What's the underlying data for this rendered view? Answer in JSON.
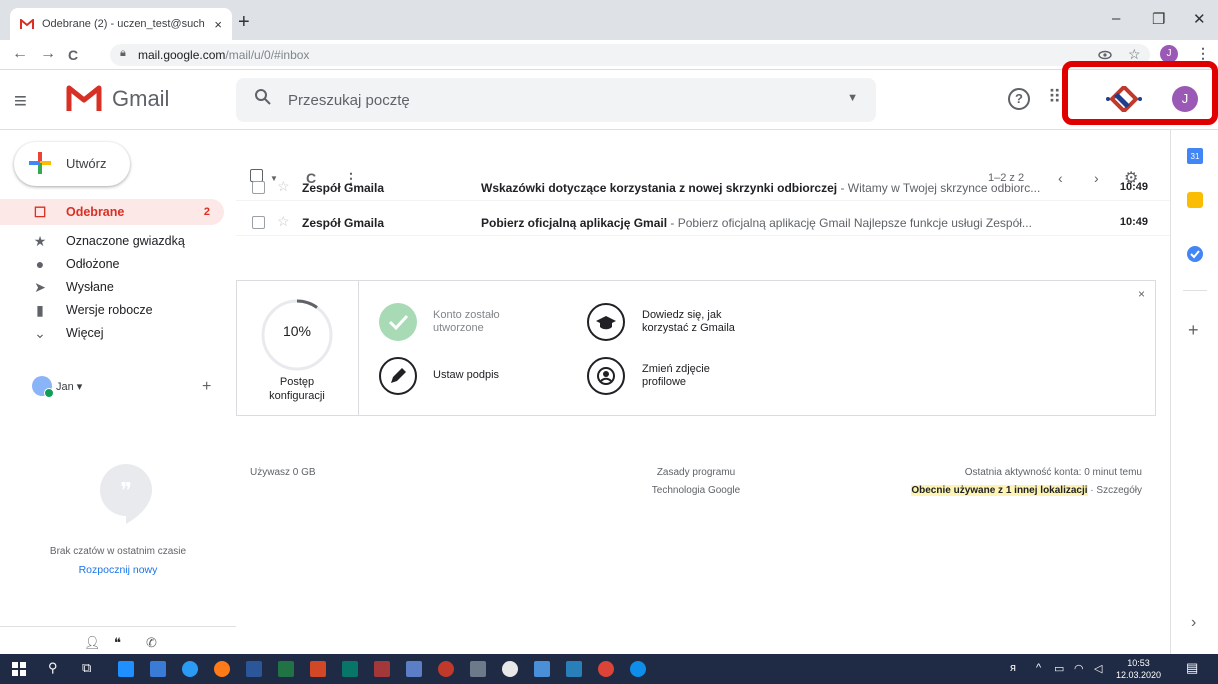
{
  "browser": {
    "tab_title": "Odebrane (2) - uczen_test@such",
    "tab_close": "×",
    "new_tab": "+",
    "url_host": "mail.google.com",
    "url_path": "/mail/u/0/#inbox",
    "window_controls": [
      "–",
      "❐",
      "✕"
    ],
    "nav": [
      "←",
      "→",
      "C"
    ]
  },
  "header": {
    "logo_text": "Gmail",
    "search_placeholder": "Przeszukaj pocztę",
    "help": "?",
    "avatar_letter": "J"
  },
  "sidebar": {
    "compose": "Utwórz",
    "items": [
      {
        "label": "Odebrane",
        "count": "2",
        "icon": "inbox-icon",
        "glyph": "☐"
      },
      {
        "label": "Oznaczone gwiazdką",
        "icon": "star-icon",
        "glyph": "★"
      },
      {
        "label": "Odłożone",
        "icon": "clock-icon",
        "glyph": "●"
      },
      {
        "label": "Wysłane",
        "icon": "send-icon",
        "glyph": "➤"
      },
      {
        "label": "Wersje robocze",
        "icon": "draft-icon",
        "glyph": "▮"
      },
      {
        "label": "Więcej",
        "icon": "chevron-down-icon",
        "glyph": "⌄"
      }
    ],
    "user_name": "Jan ▾",
    "user_plus": "+",
    "no_chats": "Brak czatów w ostatnim czasie",
    "start_new": "Rozpocznij nowy"
  },
  "toolbar": {
    "paging": "1–2 z 2"
  },
  "emails": [
    {
      "from": "Zespół Gmaila",
      "subject": "Wskazówki dotyczące korzystania z nowej skrzynki odbiorczej",
      "snippet": " - Witamy w Twojej skrzynce odbiorc...",
      "time": "10:49"
    },
    {
      "from": "Zespół Gmaila",
      "subject": "Pobierz oficjalną aplikację Gmail",
      "snippet": " - Pobierz oficjalną aplikację Gmail Najlepsze funkcje usługi Zespół...",
      "time": "10:49"
    }
  ],
  "setup": {
    "percent": "10%",
    "progress": 0.1,
    "label_line1": "Postęp",
    "label_line2": "konfiguracji",
    "tasks": [
      {
        "line1": "Konto zostało",
        "line2": "utworzone",
        "done": true
      },
      {
        "line1": "Dowiedz się, jak",
        "line2": "korzystać z Gmaila",
        "done": false
      },
      {
        "line1": "Ustaw podpis",
        "line2": "",
        "done": false
      },
      {
        "line1": "Zmień zdjęcie",
        "line2": "profilowe",
        "done": false
      }
    ],
    "close": "×"
  },
  "footer": {
    "storage": "Używasz 0 GB",
    "policy": "Zasady programu",
    "tech": "Technologia Google",
    "activity": "Ostatnia aktywność konta: 0 minut temu",
    "location_hl": "Obecnie używane z 1 innej lokalizacji",
    "details": " · Szczegóły"
  },
  "rightrail": {
    "calendar_day": "31",
    "plus": "+",
    "chevron": "›"
  },
  "taskbar": {
    "time": "10:53",
    "date": "12.03.2020"
  },
  "colors": {
    "gmail_red": "#d93025",
    "accent_blue": "#1a73e8",
    "highlight_box": "#e00000"
  }
}
